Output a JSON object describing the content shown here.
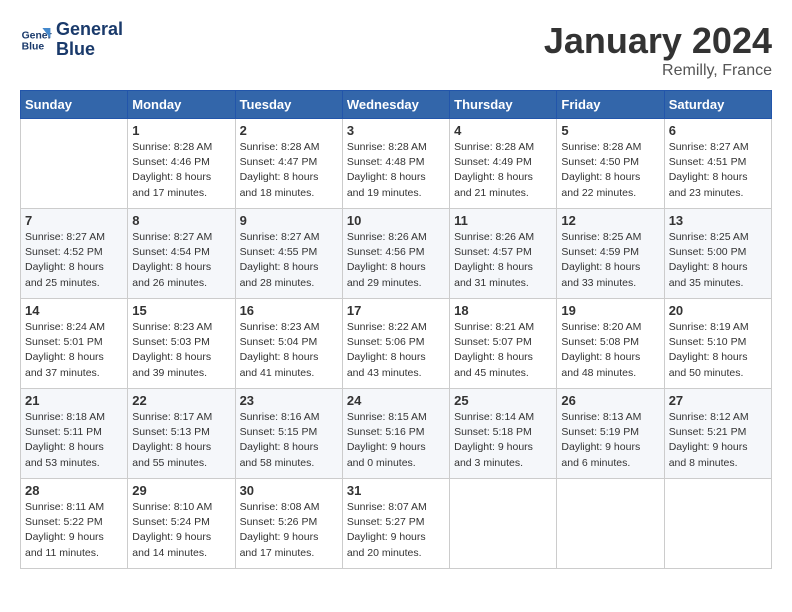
{
  "header": {
    "logo_line1": "General",
    "logo_line2": "Blue",
    "month": "January 2024",
    "location": "Remilly, France"
  },
  "weekdays": [
    "Sunday",
    "Monday",
    "Tuesday",
    "Wednesday",
    "Thursday",
    "Friday",
    "Saturday"
  ],
  "weeks": [
    [
      {
        "day": "",
        "info": ""
      },
      {
        "day": "1",
        "info": "Sunrise: 8:28 AM\nSunset: 4:46 PM\nDaylight: 8 hours\nand 17 minutes."
      },
      {
        "day": "2",
        "info": "Sunrise: 8:28 AM\nSunset: 4:47 PM\nDaylight: 8 hours\nand 18 minutes."
      },
      {
        "day": "3",
        "info": "Sunrise: 8:28 AM\nSunset: 4:48 PM\nDaylight: 8 hours\nand 19 minutes."
      },
      {
        "day": "4",
        "info": "Sunrise: 8:28 AM\nSunset: 4:49 PM\nDaylight: 8 hours\nand 21 minutes."
      },
      {
        "day": "5",
        "info": "Sunrise: 8:28 AM\nSunset: 4:50 PM\nDaylight: 8 hours\nand 22 minutes."
      },
      {
        "day": "6",
        "info": "Sunrise: 8:27 AM\nSunset: 4:51 PM\nDaylight: 8 hours\nand 23 minutes."
      }
    ],
    [
      {
        "day": "7",
        "info": "Sunrise: 8:27 AM\nSunset: 4:52 PM\nDaylight: 8 hours\nand 25 minutes."
      },
      {
        "day": "8",
        "info": "Sunrise: 8:27 AM\nSunset: 4:54 PM\nDaylight: 8 hours\nand 26 minutes."
      },
      {
        "day": "9",
        "info": "Sunrise: 8:27 AM\nSunset: 4:55 PM\nDaylight: 8 hours\nand 28 minutes."
      },
      {
        "day": "10",
        "info": "Sunrise: 8:26 AM\nSunset: 4:56 PM\nDaylight: 8 hours\nand 29 minutes."
      },
      {
        "day": "11",
        "info": "Sunrise: 8:26 AM\nSunset: 4:57 PM\nDaylight: 8 hours\nand 31 minutes."
      },
      {
        "day": "12",
        "info": "Sunrise: 8:25 AM\nSunset: 4:59 PM\nDaylight: 8 hours\nand 33 minutes."
      },
      {
        "day": "13",
        "info": "Sunrise: 8:25 AM\nSunset: 5:00 PM\nDaylight: 8 hours\nand 35 minutes."
      }
    ],
    [
      {
        "day": "14",
        "info": "Sunrise: 8:24 AM\nSunset: 5:01 PM\nDaylight: 8 hours\nand 37 minutes."
      },
      {
        "day": "15",
        "info": "Sunrise: 8:23 AM\nSunset: 5:03 PM\nDaylight: 8 hours\nand 39 minutes."
      },
      {
        "day": "16",
        "info": "Sunrise: 8:23 AM\nSunset: 5:04 PM\nDaylight: 8 hours\nand 41 minutes."
      },
      {
        "day": "17",
        "info": "Sunrise: 8:22 AM\nSunset: 5:06 PM\nDaylight: 8 hours\nand 43 minutes."
      },
      {
        "day": "18",
        "info": "Sunrise: 8:21 AM\nSunset: 5:07 PM\nDaylight: 8 hours\nand 45 minutes."
      },
      {
        "day": "19",
        "info": "Sunrise: 8:20 AM\nSunset: 5:08 PM\nDaylight: 8 hours\nand 48 minutes."
      },
      {
        "day": "20",
        "info": "Sunrise: 8:19 AM\nSunset: 5:10 PM\nDaylight: 8 hours\nand 50 minutes."
      }
    ],
    [
      {
        "day": "21",
        "info": "Sunrise: 8:18 AM\nSunset: 5:11 PM\nDaylight: 8 hours\nand 53 minutes."
      },
      {
        "day": "22",
        "info": "Sunrise: 8:17 AM\nSunset: 5:13 PM\nDaylight: 8 hours\nand 55 minutes."
      },
      {
        "day": "23",
        "info": "Sunrise: 8:16 AM\nSunset: 5:15 PM\nDaylight: 8 hours\nand 58 minutes."
      },
      {
        "day": "24",
        "info": "Sunrise: 8:15 AM\nSunset: 5:16 PM\nDaylight: 9 hours\nand 0 minutes."
      },
      {
        "day": "25",
        "info": "Sunrise: 8:14 AM\nSunset: 5:18 PM\nDaylight: 9 hours\nand 3 minutes."
      },
      {
        "day": "26",
        "info": "Sunrise: 8:13 AM\nSunset: 5:19 PM\nDaylight: 9 hours\nand 6 minutes."
      },
      {
        "day": "27",
        "info": "Sunrise: 8:12 AM\nSunset: 5:21 PM\nDaylight: 9 hours\nand 8 minutes."
      }
    ],
    [
      {
        "day": "28",
        "info": "Sunrise: 8:11 AM\nSunset: 5:22 PM\nDaylight: 9 hours\nand 11 minutes."
      },
      {
        "day": "29",
        "info": "Sunrise: 8:10 AM\nSunset: 5:24 PM\nDaylight: 9 hours\nand 14 minutes."
      },
      {
        "day": "30",
        "info": "Sunrise: 8:08 AM\nSunset: 5:26 PM\nDaylight: 9 hours\nand 17 minutes."
      },
      {
        "day": "31",
        "info": "Sunrise: 8:07 AM\nSunset: 5:27 PM\nDaylight: 9 hours\nand 20 minutes."
      },
      {
        "day": "",
        "info": ""
      },
      {
        "day": "",
        "info": ""
      },
      {
        "day": "",
        "info": ""
      }
    ]
  ]
}
